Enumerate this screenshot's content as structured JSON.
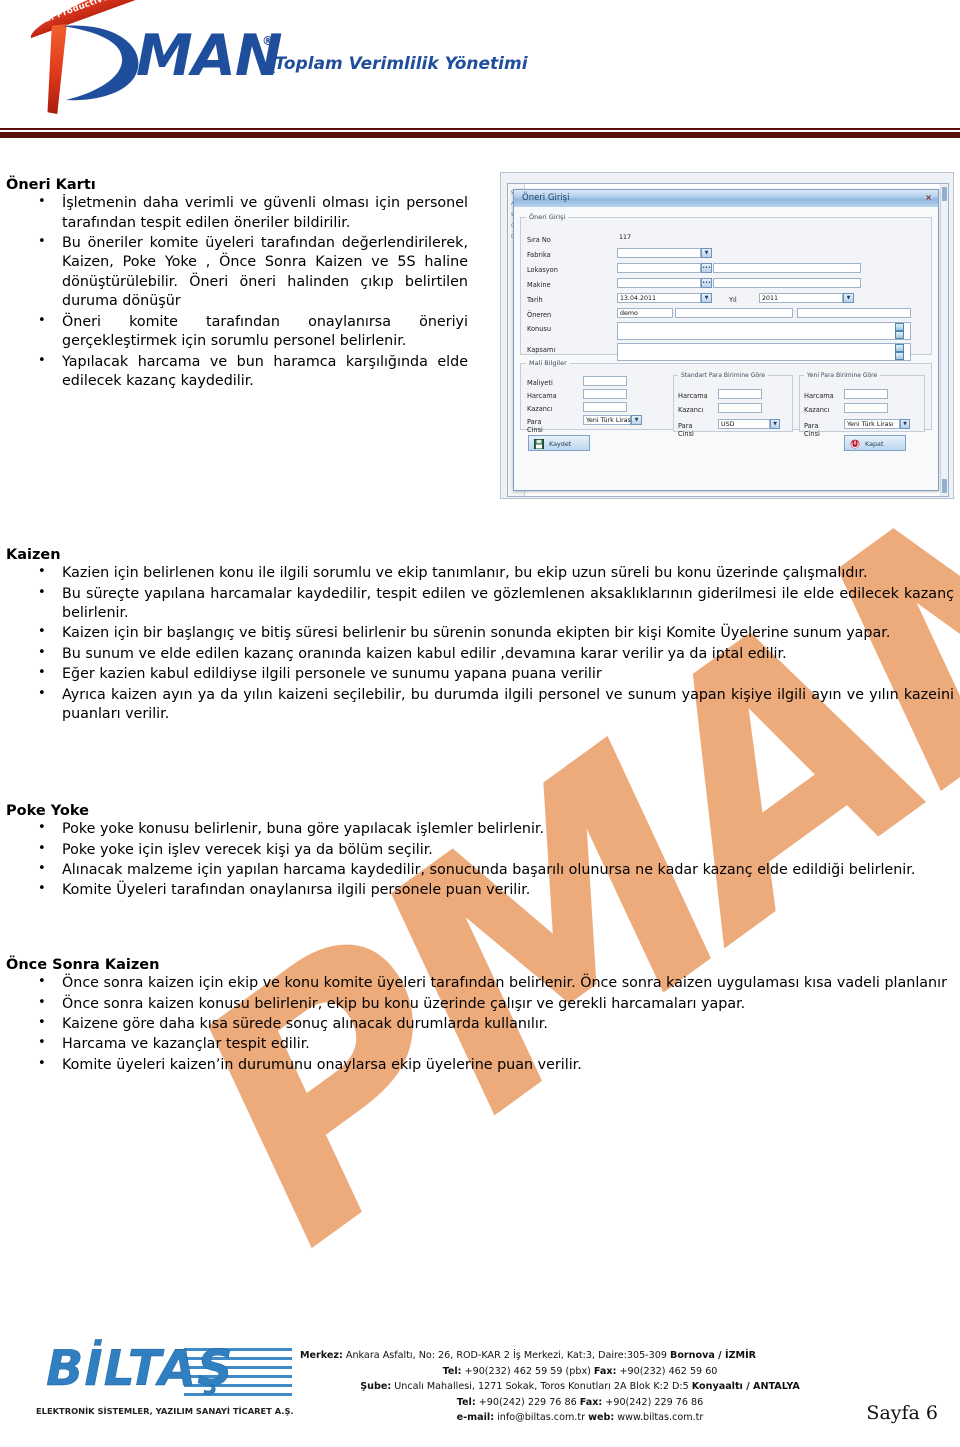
{
  "header": {
    "logo": {
      "arc_text": "Total Productive Maintenance",
      "word": "MAN",
      "registered": "®",
      "tagline": "_Toplam Verimlilik Yönetimi"
    }
  },
  "watermark": {
    "text": "PMAN"
  },
  "sections": [
    {
      "id": "oneri-karti",
      "title": "Öneri Kartı",
      "bullets": [
        "İşletmenin daha verimli ve güvenli olması için personel tarafından tespit edilen öneriler bildirilir.",
        "Bu öneriler komite üyeleri tarafından değerlendirilerek, Kaizen, Poke Yoke , Önce Sonra Kaizen ve 5S haline dönüştürülebilir. Öneri öneri halinden çıkıp belirtilen duruma dönüşür",
        "Öneri komite tarafından onaylanırsa öneriyi gerçekleştirmek için sorumlu personel belirlenir.",
        "Yapılacak harcama ve bun haramca karşılığında elde edilecek kazanç kaydedilir."
      ]
    },
    {
      "id": "kaizen",
      "title": "Kaizen",
      "bullets": [
        "Kazien için belirlenen konu ile ilgili sorumlu ve ekip tanımlanır, bu ekip uzun süreli bu konu üzerinde çalışmalıdır.",
        "Bu süreçte yapılana harcamalar kaydedilir, tespit edilen ve gözlemlenen aksaklıklarının giderilmesi ile elde edilecek kazanç belirlenir.",
        "Kaizen için bir başlangıç ve bitiş süresi belirlenir bu sürenin sonunda ekipten bir kişi Komite Üyelerine sunum yapar.",
        "Bu sunum ve elde edilen kazanç oranında kaizen kabul edilir ,devamına karar verilir ya da iptal edilir.",
        "Eğer kazien kabul edildiyse ilgili personele ve sunumu yapana puana verilir",
        "Ayrıca kaizen ayın ya da yılın kaizeni seçilebilir, bu durumda ilgili personel ve sunum yapan kişiye ilgili ayın ve yılın kazeini puanları verilir."
      ]
    },
    {
      "id": "poke-yoke",
      "title": "Poke Yoke",
      "bullets": [
        "Poke yoke konusu belirlenir, buna göre yapılacak işlemler belirlenir.",
        "Poke yoke için işlev verecek kişi ya da bölüm seçilir.",
        "Alınacak malzeme için yapılan harcama kaydedilir, sonucunda başarılı olunursa ne kadar kazanç elde edildiği belirlenir.",
        "Komite Üyeleri tarafından onaylanırsa ilgili personele puan verilir."
      ]
    },
    {
      "id": "once-sonra-kaizen",
      "title": "Önce Sonra Kaizen",
      "bullets": [
        "Önce sonra kaizen için ekip ve konu komite üyeleri tarafından belirlenir. Önce sonra kaizen uygulaması kısa vadeli planlanır",
        "Önce sonra kaizen konusu belirlenir, ekip bu konu üzerinde çalışır ve gerekli harcamaları yapar.",
        "Kaizene göre daha kısa sürede sonuç alınacak durumlarda kullanılır.",
        "Harcama ve kazançlar tespit edilir.",
        "Komite üyeleri kaizen’in durumunu onaylarsa ekip üyelerine puan verilir."
      ]
    }
  ],
  "screenshot": {
    "dialog": {
      "title": "Öneri Girişi",
      "close_label": "×",
      "group_oneri": {
        "legend": "Öneri Girişi",
        "rows": [
          {
            "label": "Sıra No",
            "value": "117"
          },
          {
            "label": "Fabrika",
            "value": ""
          },
          {
            "label": "Lokasyon",
            "value": ""
          },
          {
            "label": "Makine",
            "value": ""
          },
          {
            "label": "Tarih",
            "value": "13.04.2011"
          },
          {
            "label": "Öneren",
            "value": "demo"
          },
          {
            "label": "Konusu",
            "value": ""
          },
          {
            "label": "Kapsamı",
            "value": ""
          }
        ],
        "yil_label": "Yıl",
        "yil_value": "2011",
        "ellipsis": "•••"
      },
      "group_mali": {
        "legend": "Mali Bilgiler",
        "left_rows": [
          {
            "label": "Maliyeti",
            "value": ""
          },
          {
            "label": "Harcama",
            "value": ""
          },
          {
            "label": "Kazancı",
            "value": ""
          }
        ],
        "left_currency": {
          "label": "Para Cinsi",
          "value": "Yeni Türk Lirası"
        },
        "standart": {
          "legend": "Standart Para Birimine Göre",
          "rows": [
            {
              "label": "Harcama",
              "value": ""
            },
            {
              "label": "Kazancı",
              "value": ""
            }
          ],
          "currency": {
            "label": "Para Cinsi",
            "value": "USD"
          }
        },
        "yeni": {
          "legend": "Yeni Para Birimine Göre",
          "rows": [
            {
              "label": "Harcama",
              "value": ""
            },
            {
              "label": "Kazancı",
              "value": ""
            }
          ],
          "currency": {
            "label": "Para Cinsi",
            "value": "Yeni Türk Lirası"
          }
        }
      },
      "buttons": {
        "save": "Kaydet",
        "close": "Kapat"
      }
    },
    "host_sidebar_items": [
      "S",
      "A",
      "S",
      "C",
      "D"
    ]
  },
  "footer": {
    "logo": {
      "word": "BİLTAŞ",
      "subtitle": "ELEKTRONİK SİSTEMLER, YAZILIM SANAYİ TİCARET A.Ş."
    },
    "contact": {
      "line1_label": "Merkez:",
      "line1": "Ankara Asfaltı, No: 26, ROD-KAR 2 İş Merkezi, Kat:3, Daire:305-309",
      "line1_bold": "Bornova / İZMİR",
      "line2_label": "Tel:",
      "line2": "+90(232) 462 59 59 (pbx)",
      "line2_label2": "Fax:",
      "line2b": "+90(232) 462 59 60",
      "line3_label": "Şube:",
      "line3": "Uncalı Mahallesi, 1271 Sokak, Toros Konutları 2A Blok K:2 D:5",
      "line3_bold": "Konyaaltı / ANTALYA",
      "line4_label": "Tel:",
      "line4": "+90(242) 229 76 86",
      "line4_label2": "Fax:",
      "line4b": "+90(242) 229 76 86",
      "line5_label": "e-mail:",
      "line5": "info@biltas.com.tr",
      "line5_label2": "web:",
      "line5b": "www.biltas.com.tr"
    },
    "page_number": "Sayfa 6"
  },
  "colors": {
    "divider": "#5b1010",
    "logo_blue": "#1f4e9c",
    "logo_orange": "#e0391b",
    "watermark": "#eba06a",
    "biltas_blue": "#2f7fc1"
  }
}
